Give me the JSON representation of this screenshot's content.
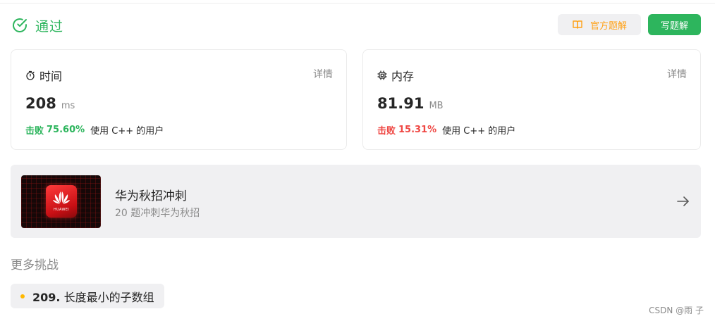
{
  "status": {
    "label": "通过",
    "color": "#2db55d"
  },
  "buttons": {
    "official_solution": "官方题解",
    "write_solution": "写题解"
  },
  "runtime": {
    "title": "时间",
    "detail": "详情",
    "value": "208",
    "unit": "ms",
    "beat_prefix": "击败",
    "beat_percent": "75.60%",
    "beat_suffix": "使用 C++ 的用户"
  },
  "memory": {
    "title": "内存",
    "detail": "详情",
    "value": "81.91",
    "unit": "MB",
    "beat_prefix": "击败",
    "beat_percent": "15.31%",
    "beat_suffix": "使用 C++ 的用户"
  },
  "promo": {
    "title": "华为秋招冲刺",
    "subtitle": "20 题冲刺华为秋招",
    "logo_text": "HUAWEI"
  },
  "more": {
    "title": "更多挑战",
    "items": [
      {
        "number": "209.",
        "title": "长度最小的子数组"
      }
    ]
  },
  "watermark": "CSDN @雨 子",
  "colors": {
    "accent_green": "#2db55d",
    "accent_orange": "#ffa116",
    "bad_red": "#ef4743",
    "muted": "#8a8a8a"
  },
  "icons": {
    "status": "check-circle-icon",
    "official": "book-icon",
    "runtime": "stopwatch-icon",
    "memory": "chip-icon",
    "promo_arrow": "arrow-right-icon"
  }
}
